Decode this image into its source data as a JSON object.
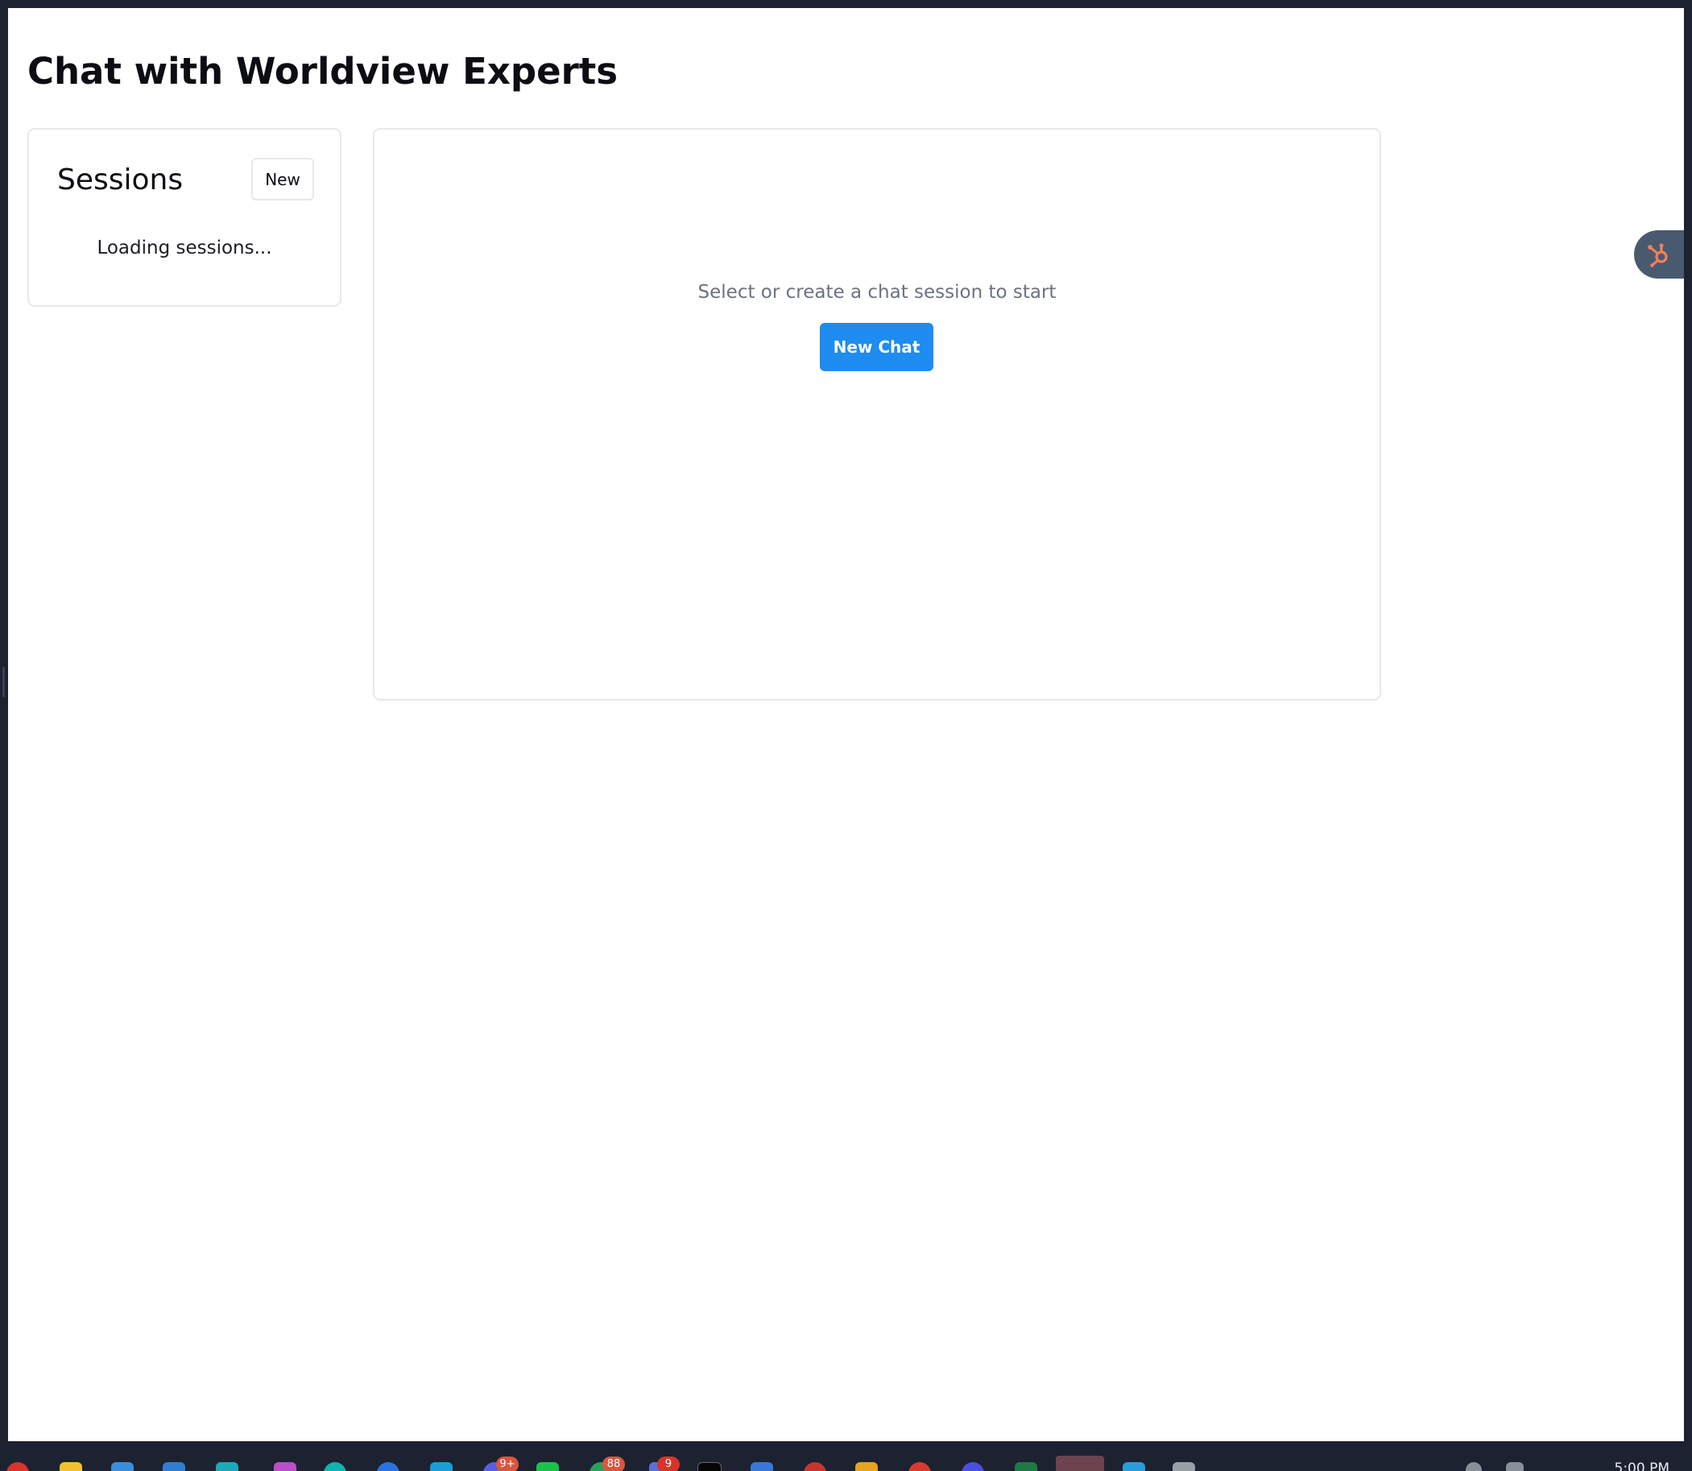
{
  "page": {
    "title": "Chat with Worldview Experts"
  },
  "sessions": {
    "title": "Sessions",
    "new_label": "New",
    "loading_text": "Loading sessions..."
  },
  "chat": {
    "empty_text": "Select or create a chat session to start",
    "new_chat_label": "New Chat"
  },
  "widget": {
    "icon": "hubspot-icon",
    "color": "#f3805c"
  },
  "taskbar": {
    "badges": [
      "9+",
      "88",
      "9"
    ],
    "clock": "5:00 PM"
  },
  "colors": {
    "accent": "#1e8cf0",
    "muted_text": "#6b7280",
    "border": "#e6e8eb",
    "frame": "#1c2230"
  }
}
